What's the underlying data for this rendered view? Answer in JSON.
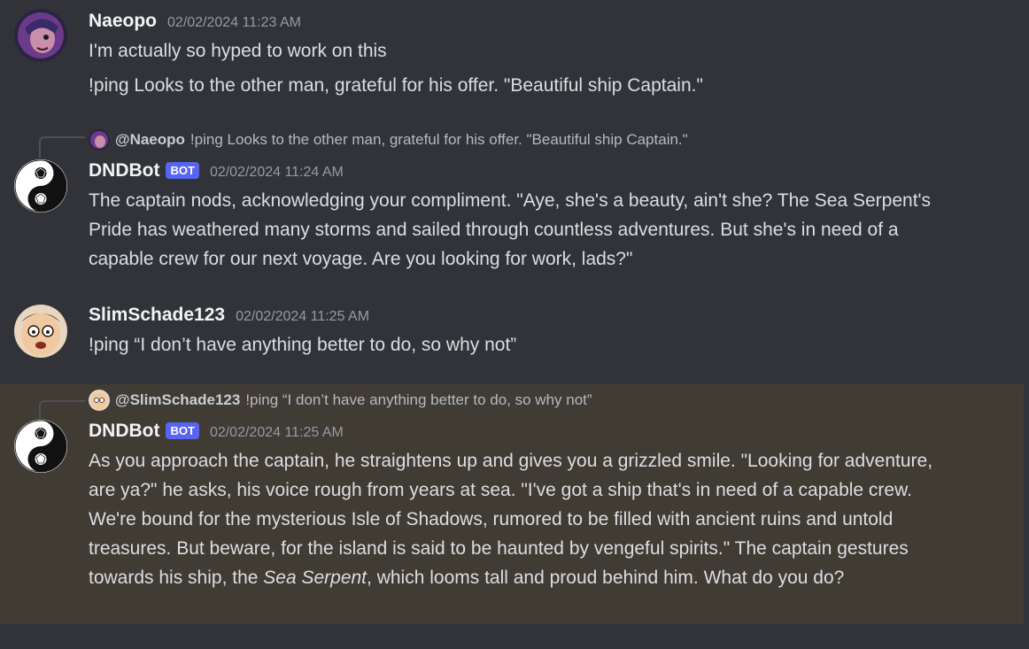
{
  "messages": [
    {
      "author": "Naeopo",
      "timestamp": "02/02/2024 11:23 AM",
      "lines": [
        "I'm actually so hyped to work on this",
        "!ping Looks to the other man, grateful for his offer. \"Beautiful ship Captain.\""
      ]
    },
    {
      "author": "DNDBot",
      "bot_tag": "BOT",
      "timestamp": "02/02/2024 11:24 AM",
      "reply": {
        "author": "@Naeopo",
        "text": "!ping Looks to the other man, grateful for his offer. \"Beautiful ship Captain.\""
      },
      "text": "The captain nods, acknowledging your compliment. \"Aye, she's a beauty, ain't she? The Sea Serpent's Pride has weathered many storms and sailed through countless adventures. But she's in need of a capable crew for our next voyage. Are you looking for work, lads?\""
    },
    {
      "author": "SlimSchade123",
      "timestamp": "02/02/2024 11:25 AM",
      "text": "!ping “I don’t have anything better to do, so why not”"
    },
    {
      "author": "DNDBot",
      "bot_tag": "BOT",
      "timestamp": "02/02/2024 11:25 AM",
      "reply": {
        "author": "@SlimSchade123",
        "text": "!ping “I don’t have anything better to do, so why not”"
      },
      "text_before": "As you approach the captain, he straightens up and gives you a grizzled smile. \"Looking for adventure, are ya?\" he asks, his voice rough from years at sea. \"I've got a ship that's in need of a capable crew. We're bound for the mysterious Isle of Shadows, rumored to be filled with ancient ruins and untold treasures. But beware, for the island is said to be haunted by vengeful spirits.\" The captain gestures towards his ship, the ",
      "text_em": "Sea Serpent",
      "text_after": ", which looms tall and proud behind him. What do you do?"
    }
  ],
  "colors": {
    "background": "#313338",
    "highlight": "#403b33",
    "bot_tag": "#5865f2",
    "timestamp": "#949ba4"
  },
  "icons": {
    "naeopo_avatar": "user-avatar-illustrated",
    "dndbot_avatar": "yin-yang-dice-icon",
    "slim_avatar": "user-avatar-cartoon-face"
  }
}
